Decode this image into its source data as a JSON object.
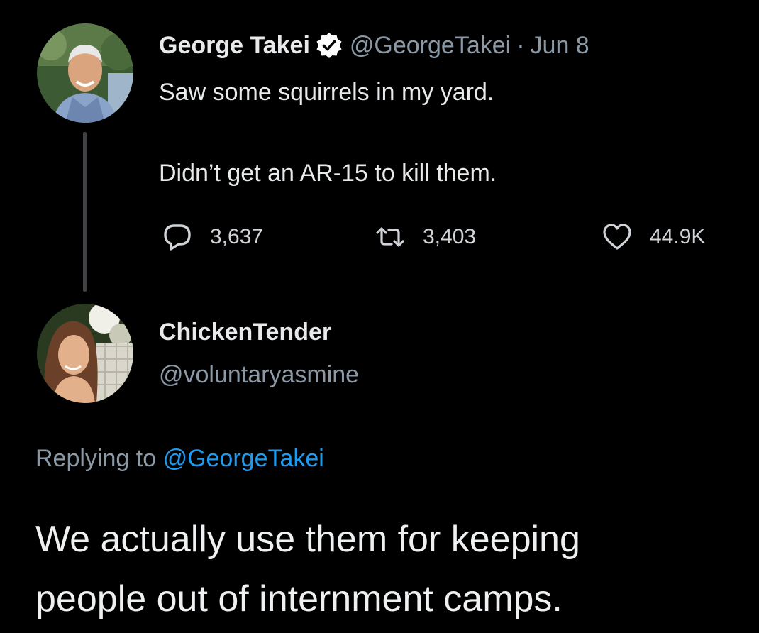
{
  "original_tweet": {
    "author": {
      "display_name": "George Takei",
      "handle": "@GeorgeTakei",
      "verified": true
    },
    "separator": "·",
    "date": "Jun 8",
    "text_lines": [
      "Saw some squirrels in my yard.",
      "Didn’t get an AR-15 to kill them."
    ],
    "actions": {
      "replies": "3,637",
      "retweets": "3,403",
      "likes": "44.9K"
    }
  },
  "reply_tweet": {
    "author": {
      "display_name": "ChickenTender",
      "handle": "@voluntaryasmine"
    },
    "replying_to_label": "Replying to",
    "replying_to_handle": "@GeorgeTakei",
    "text_lines": [
      "We actually use them for keeping",
      "people out of internment camps."
    ]
  },
  "icons": {
    "verified": "verified-badge-icon",
    "reply": "reply-bubble-icon",
    "retweet": "retweet-arrows-icon",
    "like": "heart-icon"
  },
  "colors": {
    "background": "#000000",
    "text": "#e7e9ea",
    "muted": "#8b98a5",
    "link": "#1d9bf0",
    "thread_line": "#3e4144"
  }
}
